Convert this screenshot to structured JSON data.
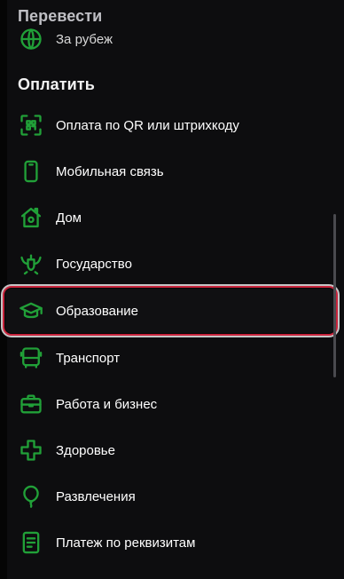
{
  "sections": {
    "transfer": {
      "title": "Перевести",
      "items": [
        {
          "label": "За рубеж",
          "icon": "globe-icon"
        }
      ]
    },
    "pay": {
      "title": "Оплатить",
      "items": [
        {
          "label": "Оплата по QR или штрихкоду",
          "icon": "qr-code-icon"
        },
        {
          "label": "Мобильная связь",
          "icon": "mobile-phone-icon"
        },
        {
          "label": "Дом",
          "icon": "house-icon"
        },
        {
          "label": "Государство",
          "icon": "coat-of-arms-icon"
        },
        {
          "label": "Образование",
          "icon": "graduation-cap-icon",
          "highlighted": true
        },
        {
          "label": "Транспорт",
          "icon": "bus-icon"
        },
        {
          "label": "Работа и бизнес",
          "icon": "briefcase-icon"
        },
        {
          "label": "Здоровье",
          "icon": "health-cross-icon"
        },
        {
          "label": "Развлечения",
          "icon": "balloon-icon"
        },
        {
          "label": "Платеж по реквизитам",
          "icon": "document-icon"
        }
      ]
    }
  },
  "colors": {
    "icon_green": "#21a038",
    "highlight_border": "#c8243c",
    "background": "#0d0d0f"
  }
}
